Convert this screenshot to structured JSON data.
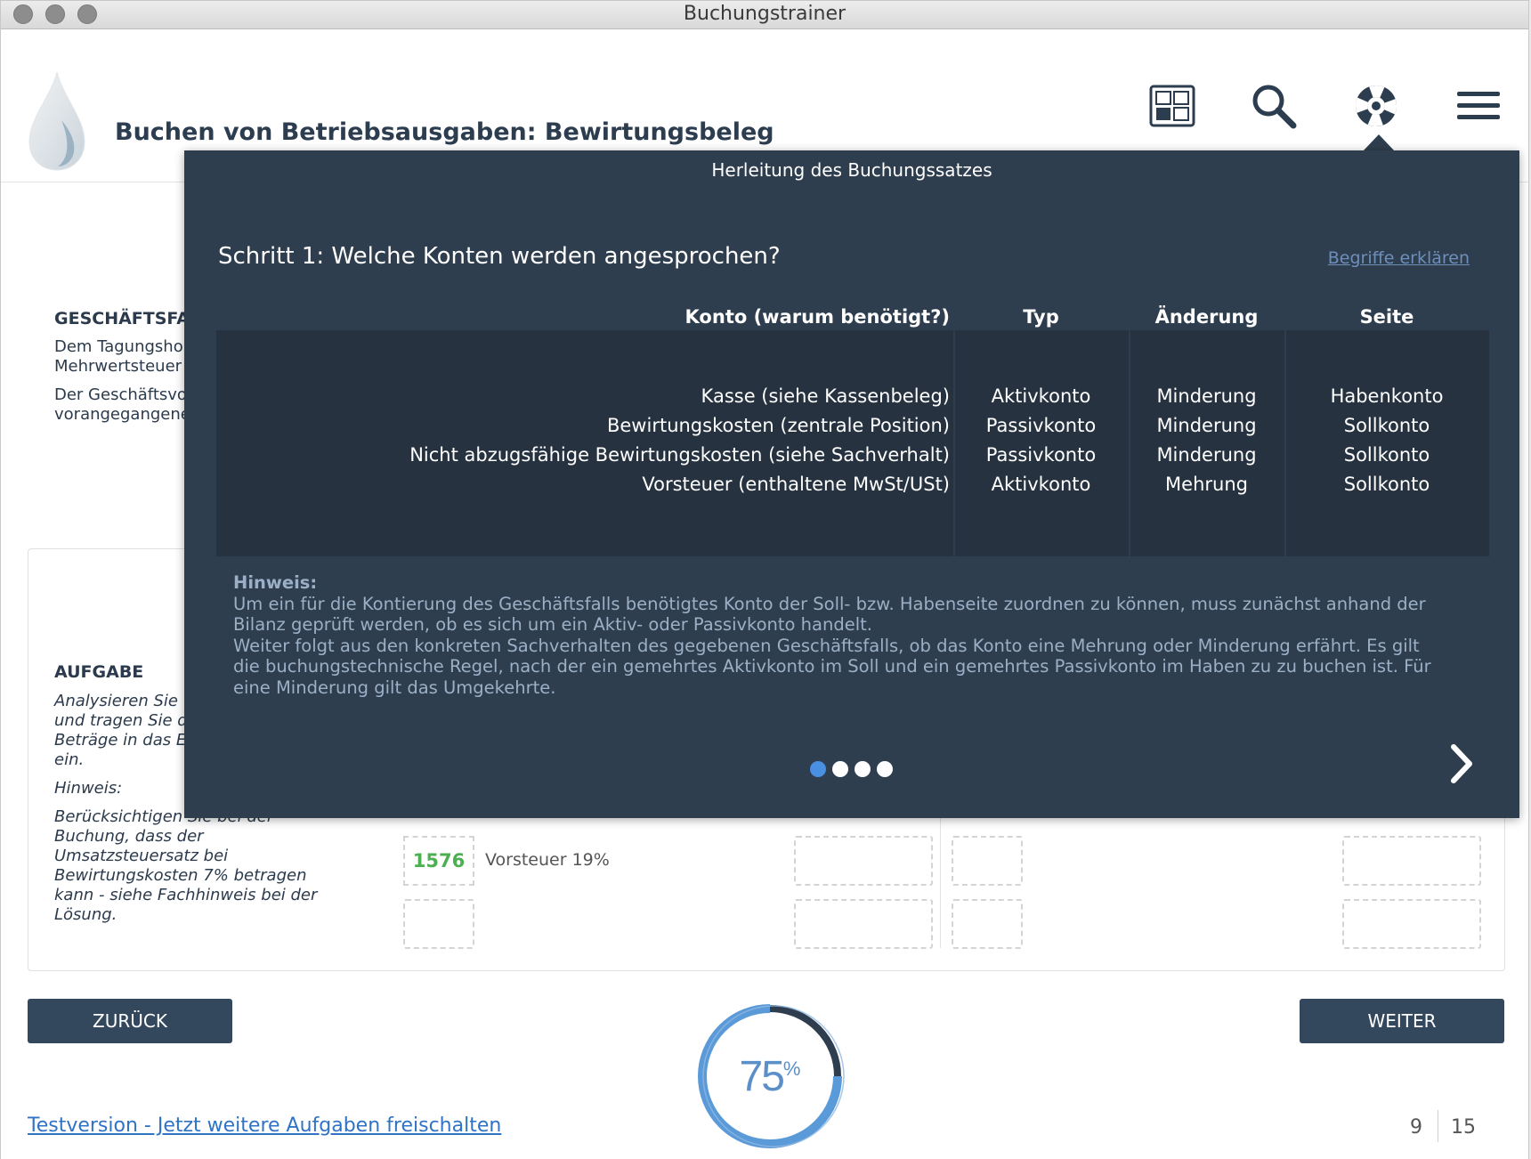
{
  "window": {
    "title": "Buchungstrainer"
  },
  "header": {
    "title": "Buchen von Betriebsausgaben: Bewirtungsbeleg",
    "icons": [
      "grid-icon",
      "search-icon",
      "help-lifebuoy-icon",
      "menu-icon"
    ]
  },
  "background": {
    "case_label": "GESCHÄFTSFA",
    "case_text_1a": "Dem Tagungsho",
    "case_text_1b": "Mehrwertsteuer",
    "case_text_2a": "Der Geschäftsvo",
    "case_text_2b": "vorangegangene",
    "task_label": "AUFGABE",
    "task_text_1": "Analysieren Sie",
    "task_text_2": "und tragen Sie d",
    "task_text_3": "Beträge in das E",
    "task_text_4": "ein.",
    "task_hint_label": "Hinweis:",
    "task_hint_1": "Berücksichtigen Sie bei der",
    "task_hint_2": "Buchung, dass der",
    "task_hint_3": "Umsatzsteuersatz bei",
    "task_hint_4": "Bewirtungskosten 7% betragen",
    "task_hint_5": "kann - siehe Fachhinweis bei der",
    "task_hint_6": "Lösung.",
    "account_number": "1576",
    "account_label": "Vorsteuer 19%"
  },
  "overlay": {
    "title": "Herleitung des Buchungssatzes",
    "step": "Schritt 1: Welche Konten werden angesprochen?",
    "explain_link": "Begriffe erklären",
    "columns": [
      "Konto (warum benötigt?)",
      "Typ",
      "Änderung",
      "Seite"
    ],
    "rows": [
      {
        "konto": "Kasse (siehe Kassenbeleg)",
        "typ": "Aktivkonto",
        "aenderung": "Minderung",
        "seite": "Habenkonto"
      },
      {
        "konto": "Bewirtungskosten (zentrale Position)",
        "typ": "Passivkonto",
        "aenderung": "Minderung",
        "seite": "Sollkonto"
      },
      {
        "konto": "Nicht abzugsfähige Bewirtungskosten (siehe Sachverhalt)",
        "typ": "Passivkonto",
        "aenderung": "Minderung",
        "seite": "Sollkonto"
      },
      {
        "konto": "Vorsteuer (enthaltene MwSt/USt)",
        "typ": "Aktivkonto",
        "aenderung": "Mehrung",
        "seite": "Sollkonto"
      }
    ],
    "hint_title": "Hinweis:",
    "hint_lines": [
      "Um ein für die Kontierung des Geschäftsfalls benötigtes Konto der Soll- bzw. Habenseite zuordnen zu können, muss zunächst anhand der",
      "Bilanz geprüft werden, ob es sich um ein Aktiv- oder Passivkonto handelt.",
      "Weiter folgt aus den konkreten Sachverhalten des gegebenen Geschäftsfalls, ob das Konto eine Mehrung oder Minderung erfährt. Es gilt",
      "die buchungstechnische Regel, nach der ein gemehrtes Aktivkonto im Soll und ein gemehrtes Passivkonto im Haben zu zu buchen ist. Für",
      "eine Minderung gilt das Umgekehrte."
    ],
    "pager_total": 4,
    "pager_active": 1
  },
  "footer": {
    "back_label": "ZURÜCK",
    "next_label": "WEITER",
    "progress_value": "75",
    "progress_unit": "%",
    "progress_fraction": 0.75,
    "trial_link": "Testversion - Jetzt weitere Aufgaben freischalten",
    "page_current": "9",
    "page_total": "15"
  },
  "colors": {
    "overlay_bg": "#2f3e4e",
    "table_bg": "#26323f",
    "button_bg": "#34485d",
    "accent_blue": "#4a90e2",
    "success_green": "#4caf50"
  }
}
